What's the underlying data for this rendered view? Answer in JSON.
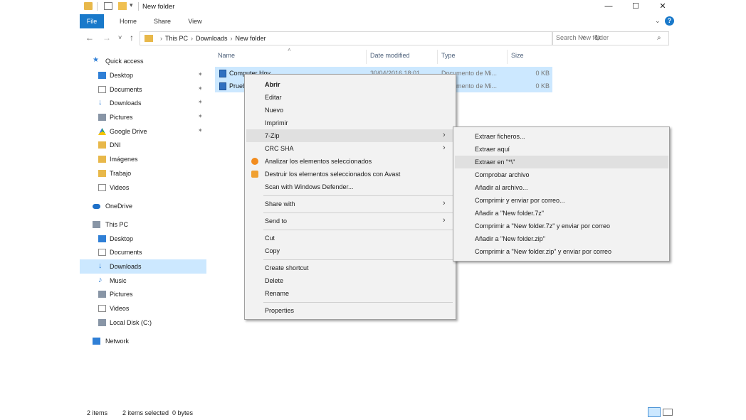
{
  "window": {
    "title": "New folder",
    "minimize": "—",
    "maximize": "☐",
    "close": "✕"
  },
  "quick_access_arrow": "▾",
  "ribbon": {
    "tabs": [
      "File",
      "Home",
      "Share",
      "View"
    ],
    "expand": "⌄",
    "help": "?"
  },
  "nav": {
    "back": "←",
    "forward": "→",
    "recent": "˅",
    "up": "↑"
  },
  "address": {
    "crumbs": [
      "This PC",
      "Downloads",
      "New folder"
    ],
    "separator": "›",
    "dropdown": "˅",
    "refresh": "↻"
  },
  "search": {
    "placeholder": "Search New folder",
    "icon": "⌕"
  },
  "navpane": {
    "pin": "✶",
    "items": [
      {
        "label": "Quick access",
        "icon": "star-icon"
      },
      {
        "label": "Desktop",
        "icon": "desktop-icon",
        "pinned": true
      },
      {
        "label": "Documents",
        "icon": "documents-icon",
        "pinned": true
      },
      {
        "label": "Downloads",
        "icon": "downloads-icon",
        "pinned": true
      },
      {
        "label": "Pictures",
        "icon": "pictures-icon",
        "pinned": true
      },
      {
        "label": "Google Drive",
        "icon": "google-drive-icon",
        "pinned": true
      },
      {
        "label": "DNI",
        "icon": "folder-icon"
      },
      {
        "label": "Imágenes",
        "icon": "folder-icon"
      },
      {
        "label": "Trabajo",
        "icon": "folder-icon"
      },
      {
        "label": "Videos",
        "icon": "videos-icon"
      },
      {
        "label": "OneDrive",
        "icon": "onedrive-icon"
      },
      {
        "label": "This PC",
        "icon": "computer-icon"
      },
      {
        "label": "Desktop",
        "icon": "desktop-icon"
      },
      {
        "label": "Documents",
        "icon": "documents-icon"
      },
      {
        "label": "Downloads",
        "icon": "downloads-icon",
        "selected": true
      },
      {
        "label": "Music",
        "icon": "music-icon"
      },
      {
        "label": "Pictures",
        "icon": "pictures-icon"
      },
      {
        "label": "Videos",
        "icon": "videos-icon"
      },
      {
        "label": "Local Disk (C:)",
        "icon": "disk-icon"
      },
      {
        "label": "Network",
        "icon": "network-icon"
      }
    ]
  },
  "columns": {
    "name": "Name",
    "date": "Date modified",
    "type": "Type",
    "size": "Size",
    "sort_arrow": "˄"
  },
  "files": [
    {
      "name": "Computer Hoy",
      "date": "30/04/2016 18:01",
      "type": "Documento de Mi...",
      "size": "0 KB"
    },
    {
      "name": "Prueba",
      "date": "",
      "type": "Documento de Mi...",
      "size": "0 KB"
    }
  ],
  "context_menu": {
    "arrow": "›",
    "items": [
      {
        "label": "Abrir"
      },
      {
        "label": "Editar"
      },
      {
        "label": "Nuevo"
      },
      {
        "label": "Imprimir"
      },
      {
        "label": "7-Zip"
      },
      {
        "label": "CRC SHA"
      },
      {
        "label": "Analizar los elementos seleccionados"
      },
      {
        "label": "Destruir los elementos seleccionados con Avast"
      },
      {
        "label": "Scan with Windows Defender..."
      },
      {
        "label": "Share with"
      },
      {
        "label": "Send to"
      },
      {
        "label": "Cut"
      },
      {
        "label": "Copy"
      },
      {
        "label": "Create shortcut"
      },
      {
        "label": "Delete"
      },
      {
        "label": "Rename"
      },
      {
        "label": "Properties"
      }
    ]
  },
  "submenu_7zip": {
    "items": [
      {
        "label": "Extraer ficheros..."
      },
      {
        "label": "Extraer aquí"
      },
      {
        "label": "Extraer en \"*\\\""
      },
      {
        "label": "Comprobar archivo"
      },
      {
        "label": "Añadir al archivo..."
      },
      {
        "label": "Comprimir y enviar por correo..."
      },
      {
        "label": "Añadir a \"New folder.7z\""
      },
      {
        "label": "Comprimir a \"New folder.7z\" y enviar por correo"
      },
      {
        "label": "Añadir a \"New folder.zip\""
      },
      {
        "label": "Comprimir a \"New folder.zip\" y enviar por correo"
      }
    ]
  },
  "statusbar": {
    "count": "2 items",
    "selection": "2 items selected  0 bytes"
  },
  "colors": {
    "accent": "#1979ca",
    "selection": "#cce8ff",
    "menu_bg": "#f2f2f2"
  }
}
